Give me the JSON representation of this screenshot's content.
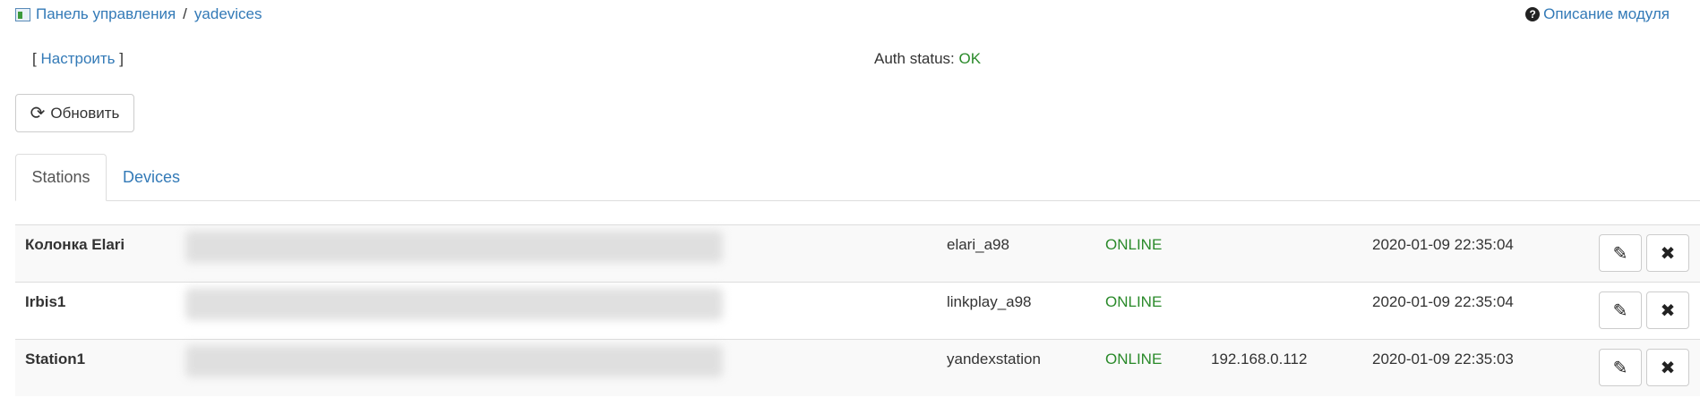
{
  "breadcrumb": {
    "home": "Панель управления",
    "separator": "/",
    "module": "yadevices"
  },
  "help_link": "Описание модуля",
  "configure": {
    "open": "[",
    "label": "Настроить",
    "close": "]"
  },
  "auth": {
    "label": "Auth status:",
    "value": "OK"
  },
  "refresh_button": "Обновить",
  "tabs": [
    {
      "label": "Stations",
      "active": true
    },
    {
      "label": "Devices",
      "active": false
    }
  ],
  "stations": [
    {
      "name": "Колонка Elari",
      "model": "elari_a98",
      "status": "ONLINE",
      "ip": "",
      "updated": "2020-01-09 22:35:04"
    },
    {
      "name": "Irbis1",
      "model": "linkplay_a98",
      "status": "ONLINE",
      "ip": "",
      "updated": "2020-01-09 22:35:04"
    },
    {
      "name": "Station1",
      "model": "yandexstation",
      "status": "ONLINE",
      "ip": "192.168.0.112",
      "updated": "2020-01-09 22:35:03"
    }
  ],
  "icons": {
    "edit": "pencil-icon",
    "delete": "close-icon",
    "refresh": "refresh-icon",
    "help": "question-circle-icon",
    "module": "module-icon"
  },
  "colors": {
    "link": "#337ab7",
    "ok": "#2a8a2a"
  }
}
